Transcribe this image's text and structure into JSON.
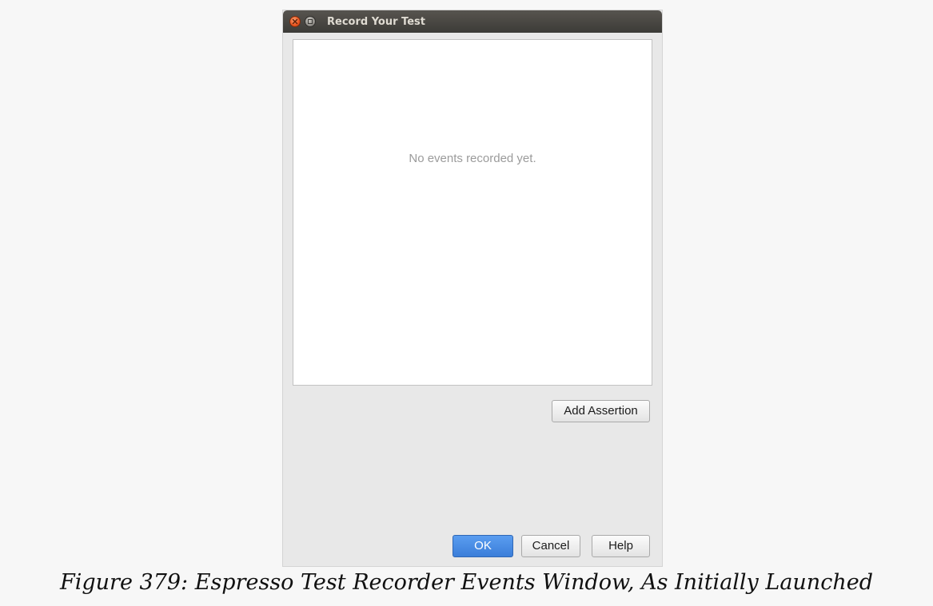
{
  "window": {
    "title": "Record Your Test"
  },
  "events_list": {
    "empty_message": "No events recorded yet."
  },
  "buttons": {
    "add_assertion": "Add Assertion",
    "ok": "OK",
    "cancel": "Cancel",
    "help": "Help"
  },
  "caption": "Figure 379: Espresso Test Recorder Events Window, As Initially Launched",
  "icons": {
    "close": "close-icon",
    "maximize": "maximize-icon"
  },
  "colors": {
    "titlebar": "#3c3b37",
    "close_button": "#e9541f",
    "ok_button": "#3b7ed9"
  }
}
